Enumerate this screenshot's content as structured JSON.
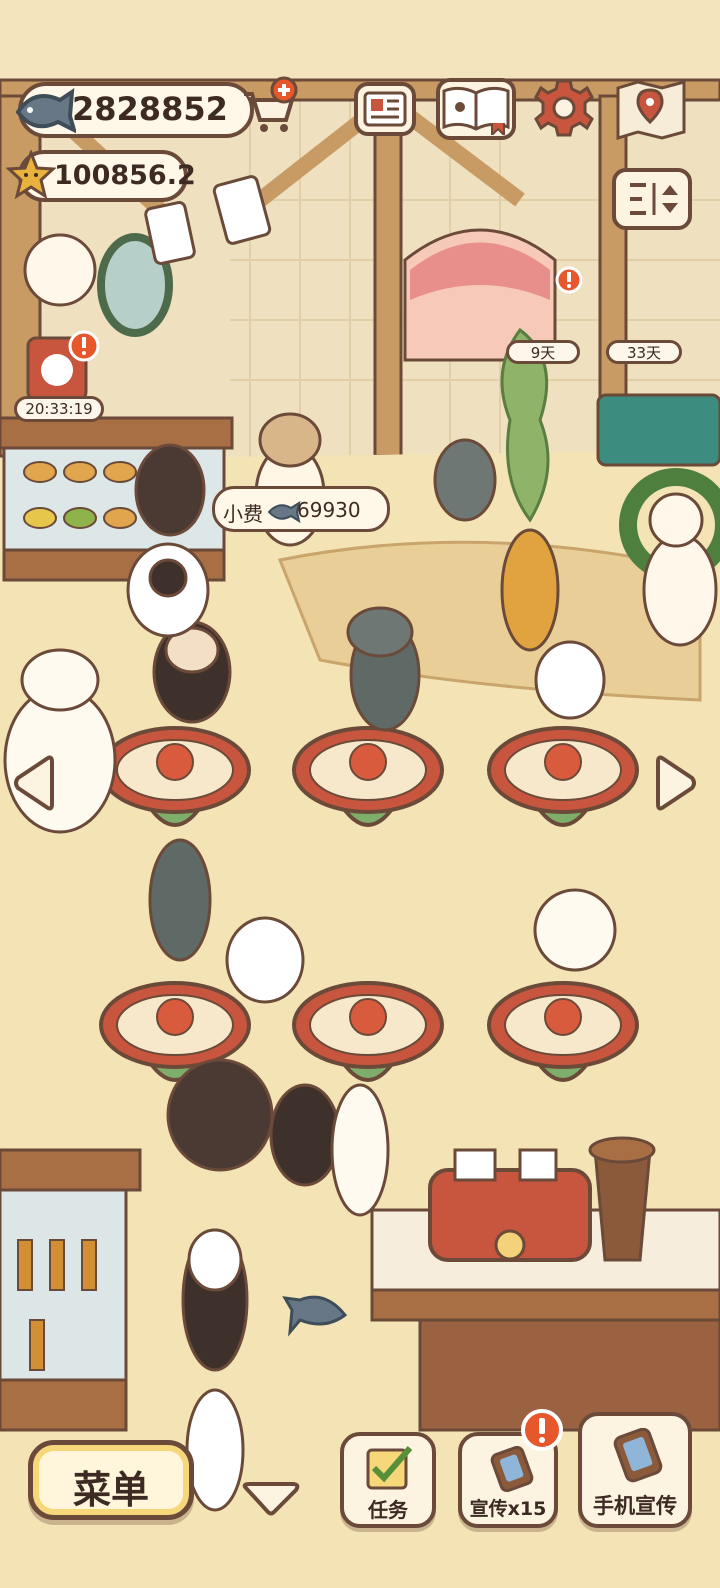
{
  "hud": {
    "fish_currency": "2828852",
    "star_currency": "100856.2",
    "timer": "20:33:19",
    "tip_label": "小费",
    "tip_amount": "69930",
    "day_badges": [
      "9天",
      "33天"
    ]
  },
  "bottom_bar": {
    "menu_label": "菜单",
    "tasks_label": "任务",
    "promo_label": "宣传x15",
    "phone_promo_label": "手机宣传"
  },
  "colors": {
    "background": "#f3e4bd",
    "outline": "#6b4a39",
    "table_top": "#c8553d",
    "table_base": "#7fae6a",
    "alert": "#e6582b"
  },
  "icons": [
    "fish-icon",
    "cart-plus-icon",
    "star-face-icon",
    "newspaper-icon",
    "paw-book-icon",
    "gear-icon",
    "map-pin-icon",
    "sort-icon",
    "arrow-left-icon",
    "arrow-right-icon",
    "task-check-icon",
    "phone-icon",
    "chevron-down-icon"
  ]
}
